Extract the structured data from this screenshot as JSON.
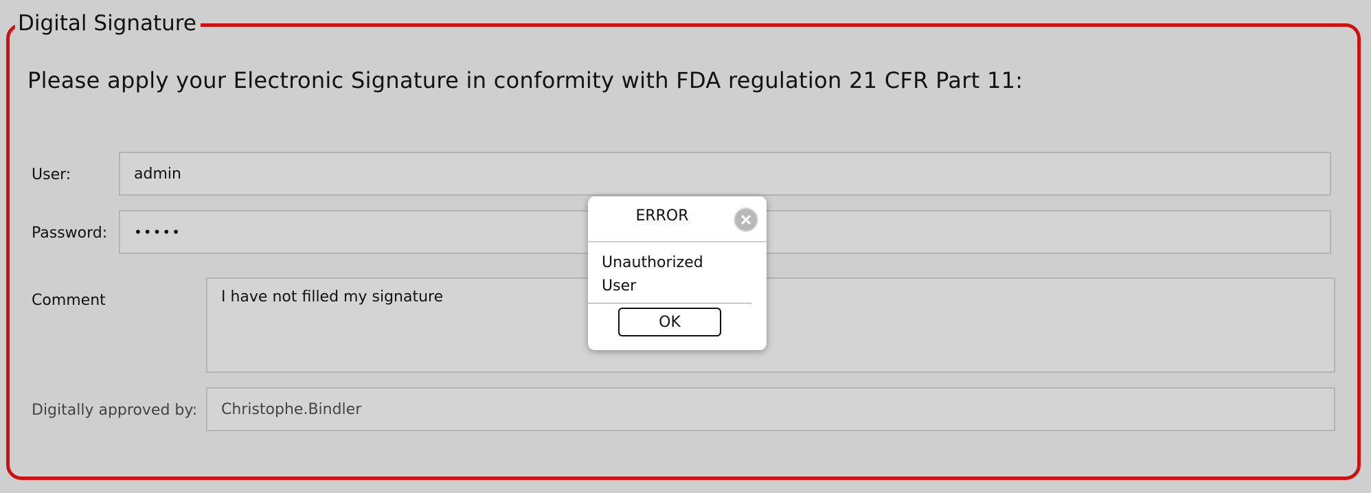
{
  "panel": {
    "title": "Digital Signature",
    "instruction": "Please apply your Electronic Signature in conformity with FDA regulation 21 CFR Part 11:",
    "border_color": "#cc1111"
  },
  "form": {
    "user_label": "User:",
    "user_value": "admin",
    "password_label": "Password:",
    "password_value": "•••••",
    "comment_label": "Comment",
    "comment_value": "I have not filled my signature",
    "approved_label": "Digitally approved by:",
    "approved_value": "Christophe.Bindler"
  },
  "dialog": {
    "title": "ERROR",
    "message": "Unauthorized User",
    "ok_label": "OK",
    "close_icon": "close-circle-icon"
  }
}
